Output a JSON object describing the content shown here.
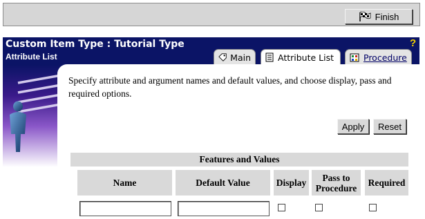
{
  "toolbar": {
    "finish_label": "Finish"
  },
  "header": {
    "title": "Custom Item Type : Tutorial Type",
    "subtitle": "Attribute List",
    "help_glyph": "?"
  },
  "tabs": [
    {
      "label": "Main",
      "icon": "tag-icon",
      "active": false
    },
    {
      "label": "Attribute List",
      "icon": "document-icon",
      "active": true
    },
    {
      "label": "Procedure",
      "icon": "procedure-icon",
      "active": false
    }
  ],
  "main": {
    "instructions": "Specify attribute and argument names and default values, and choose display, pass and required options.",
    "apply_label": "Apply",
    "reset_label": "Reset"
  },
  "table": {
    "section_title": "Features and Values",
    "columns": [
      "Name",
      "Default Value",
      "Display",
      "Pass to Procedure",
      "Required"
    ],
    "rows": [
      {
        "name": "",
        "default_value": "",
        "display": false,
        "pass_to_procedure": false,
        "required": false
      }
    ]
  },
  "colors": {
    "header_bg": "#0b1466",
    "help_icon": "#f4d000",
    "toolbar_bg": "#d6d6d6",
    "table_header_bg": "#d9d9d9"
  }
}
